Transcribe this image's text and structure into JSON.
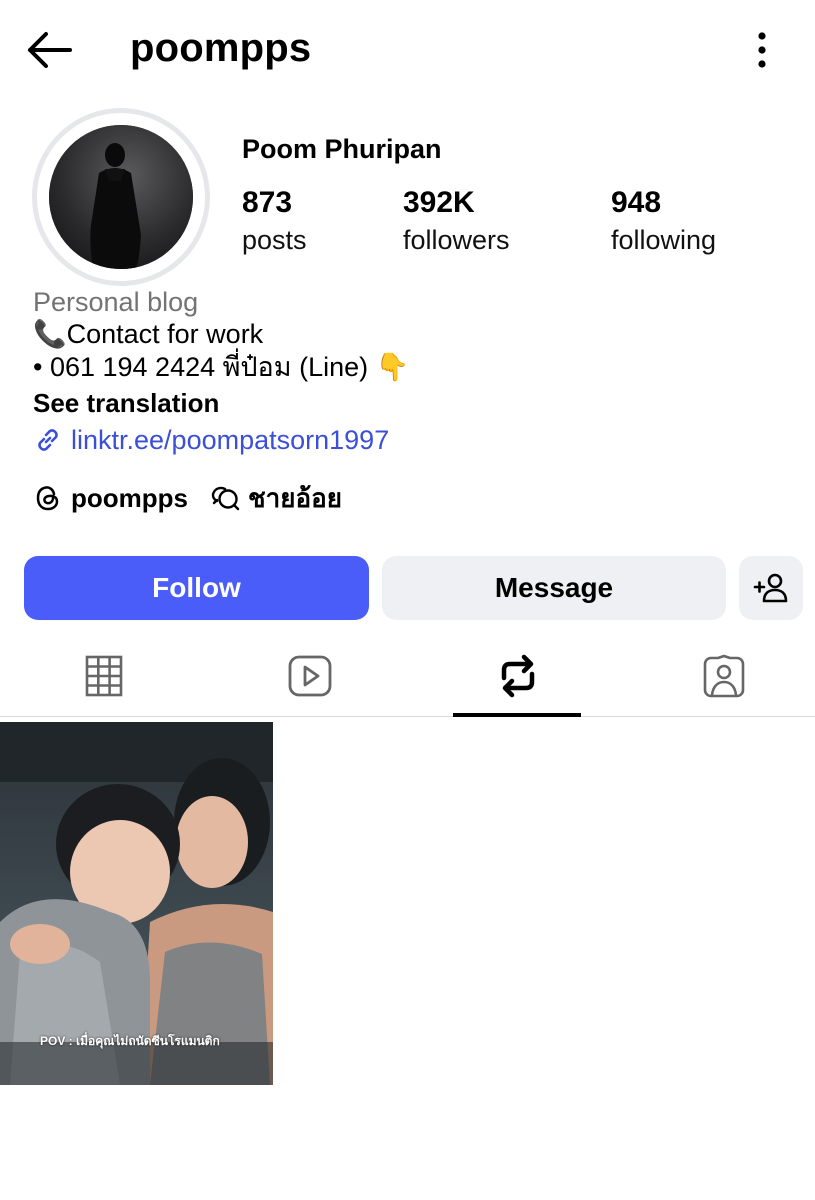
{
  "header": {
    "username": "poompps",
    "back_icon": "arrow-left-icon",
    "more_icon": "more-vertical-icon"
  },
  "profile": {
    "full_name": "Poom Phuripan",
    "stats": [
      {
        "value": "873",
        "label": "posts"
      },
      {
        "value": "392K",
        "label": "followers"
      },
      {
        "value": "948",
        "label": "following"
      }
    ]
  },
  "bio": {
    "category": "Personal blog",
    "line1": "📞Contact for work",
    "line2": "• 061 194 2424 พี่ป๋อม (Line) 👇",
    "see_translation": "See translation",
    "link": "linktr.ee/poompatsorn1997"
  },
  "threads": {
    "handle": "poompps",
    "chat_name": "ชายอ้อย"
  },
  "actions": {
    "follow": "Follow",
    "message": "Message"
  },
  "tabs": [
    "grid-icon",
    "reels-icon",
    "reposts-icon",
    "tagged-icon"
  ],
  "active_tab": 2,
  "posts": [
    {
      "caption": "POV : เมื่อคุณไม่ถนัดซีนโรแมนติก"
    }
  ],
  "colors": {
    "follow_button": "#4a5df9",
    "secondary_button": "#eff0f3",
    "link": "#3b4fd8",
    "category_text": "#737373"
  }
}
